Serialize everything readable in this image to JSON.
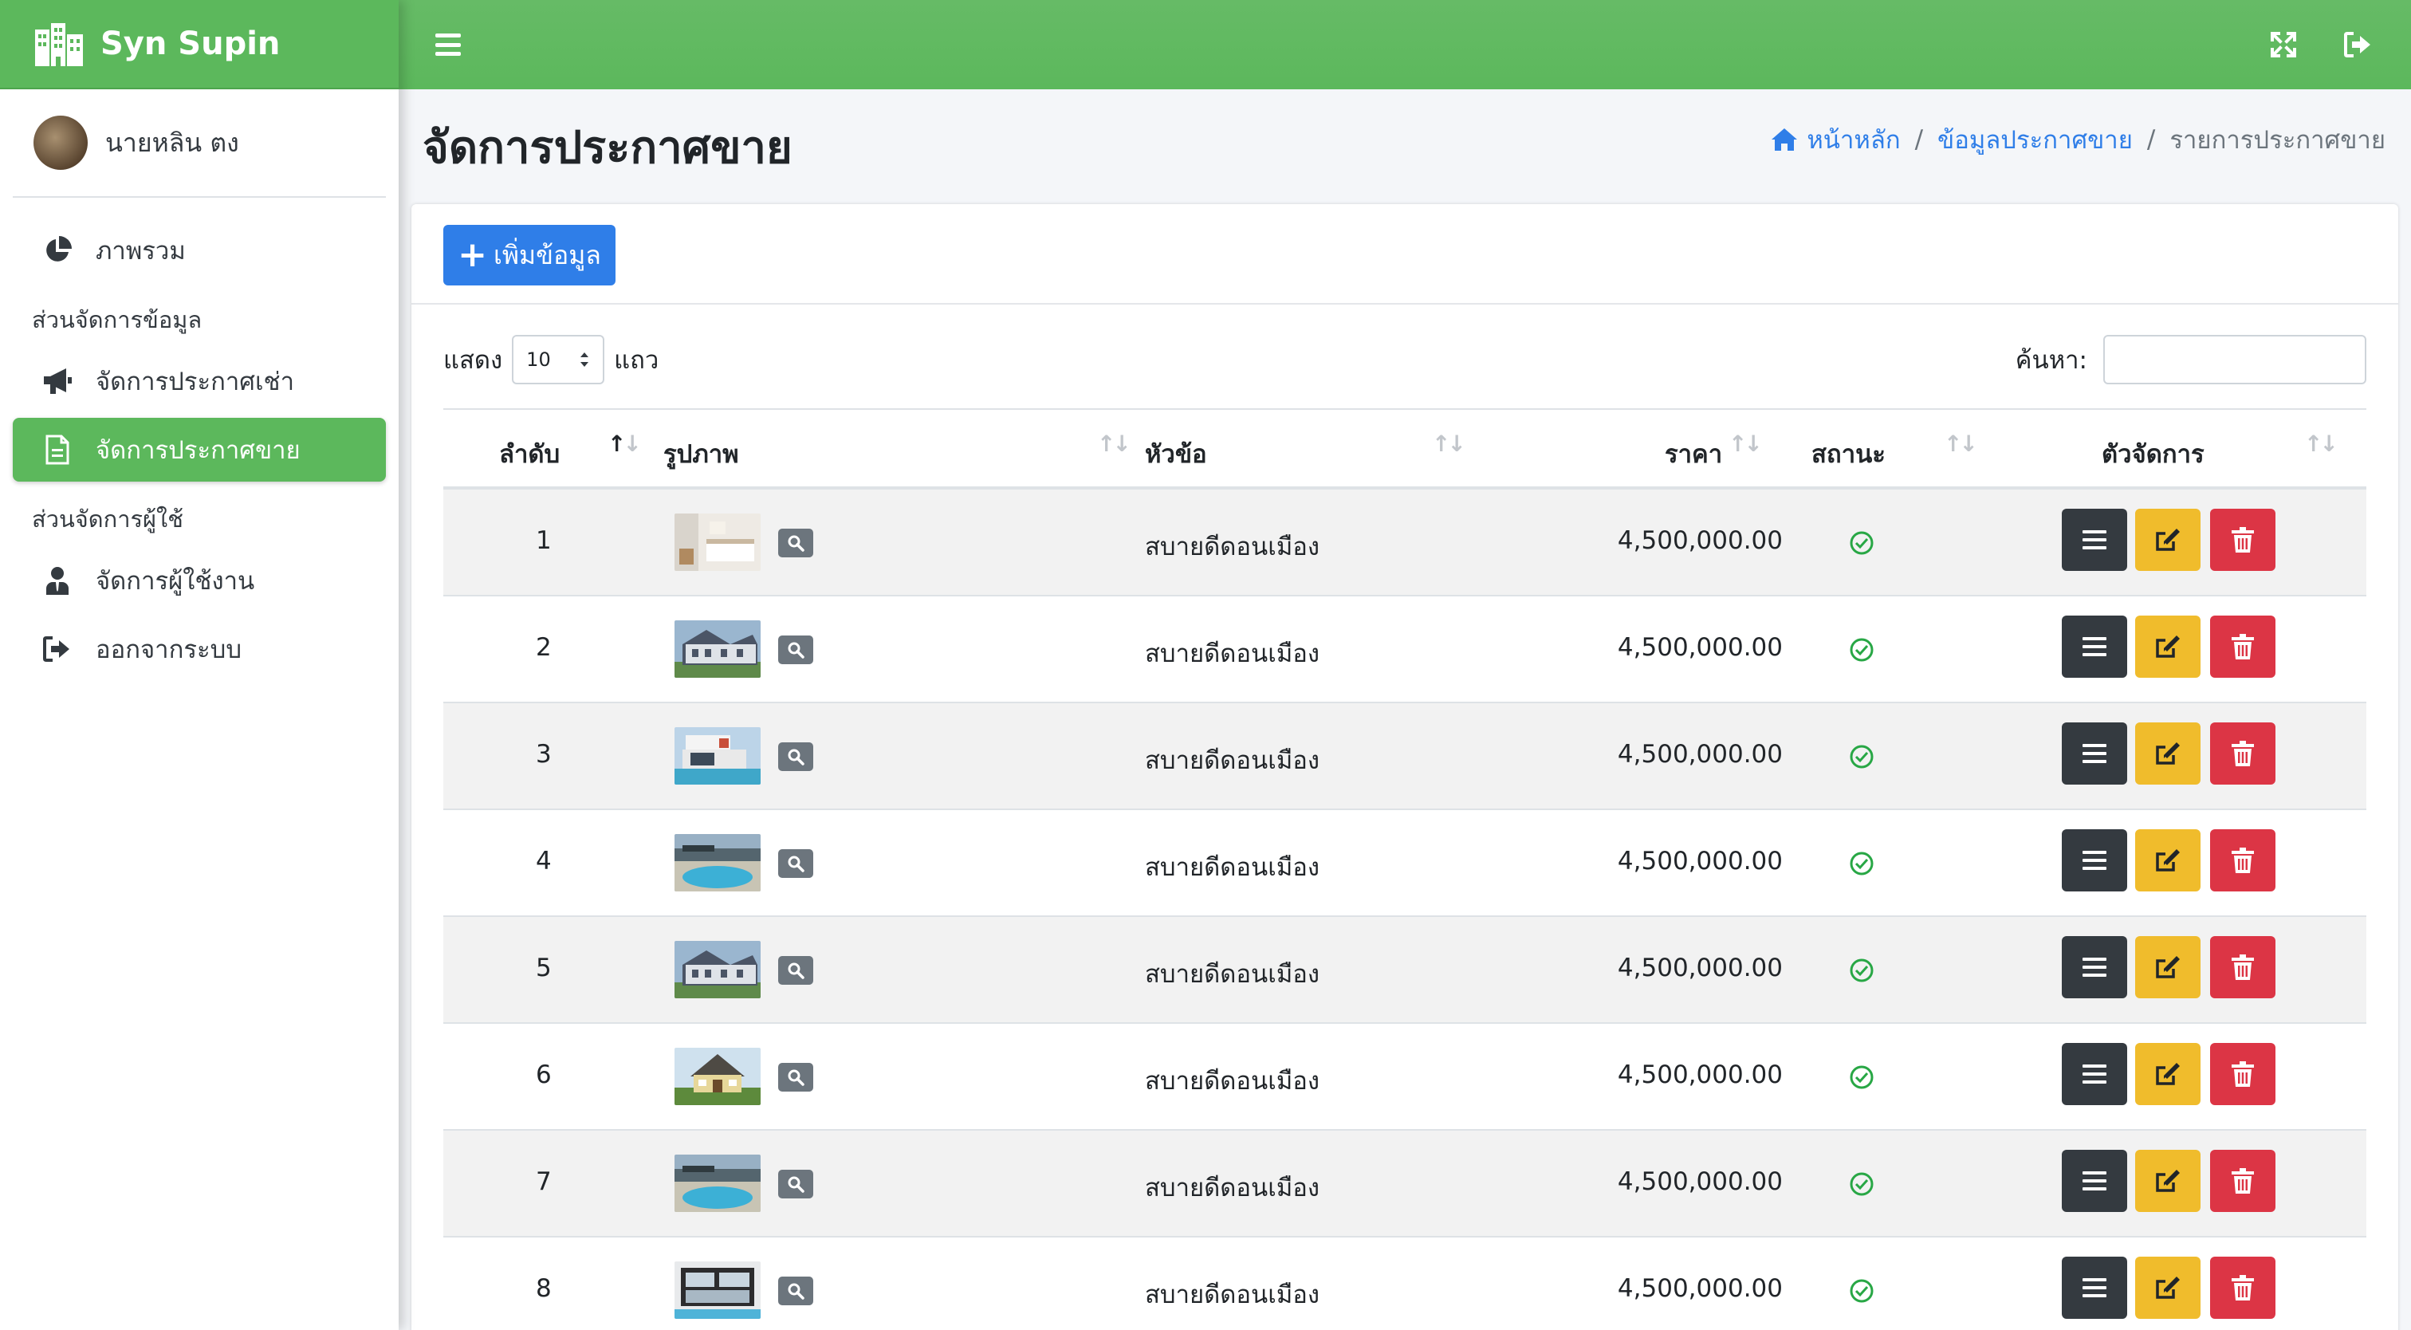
{
  "app": {
    "brand": "Syn Supin"
  },
  "user": {
    "name": "นายหลิน ตง"
  },
  "sidebar": {
    "overview": "ภาพรวม",
    "section_data": "ส่วนจัดการข้อมูล",
    "rent": "จัดการประกาศเช่า",
    "sale": "จัดการประกาศขาย",
    "section_users": "ส่วนจัดการผู้ใช้",
    "users": "จัดการผู้ใช้งาน",
    "logout": "ออกจากระบบ"
  },
  "page": {
    "title": "จัดการประกาศขาย"
  },
  "breadcrumb": {
    "home": "หน้าหลัก",
    "data": "ข้อมูลประกาศขาย",
    "current": "รายการประกาศขาย",
    "separator": "/"
  },
  "toolbar": {
    "add_label": "เพิ่มข้อมูล"
  },
  "table_controls": {
    "show_label": "แสดง",
    "page_size": "10",
    "rows_label": "แถว",
    "search_label": "ค้นหา:"
  },
  "table": {
    "columns": [
      "ลำดับ",
      "รูปภาพ",
      "หัวข้อ",
      "ราคา",
      "สถานะ",
      "ตัวจัดการ"
    ],
    "rows": [
      {
        "no": "1",
        "title": "สบายดีดอนเมือง",
        "price": "4,500,000.00",
        "thumb": "bedroom"
      },
      {
        "no": "2",
        "title": "สบายดีดอนเมือง",
        "price": "4,500,000.00",
        "thumb": "house-gray"
      },
      {
        "no": "3",
        "title": "สบายดีดอนเมือง",
        "price": "4,500,000.00",
        "thumb": "modern-pool"
      },
      {
        "no": "4",
        "title": "สบายดีดอนเมือง",
        "price": "4,500,000.00",
        "thumb": "pool"
      },
      {
        "no": "5",
        "title": "สบายดีดอนเมือง",
        "price": "4,500,000.00",
        "thumb": "house-gray"
      },
      {
        "no": "6",
        "title": "สบายดีดอนเมือง",
        "price": "4,500,000.00",
        "thumb": "house-yellow"
      },
      {
        "no": "7",
        "title": "สบายดีดอนเมือง",
        "price": "4,500,000.00",
        "thumb": "pool"
      },
      {
        "no": "8",
        "title": "สบายดีดอนเมือง",
        "price": "4,500,000.00",
        "thumb": "modern-dark"
      }
    ]
  },
  "colors": {
    "brand_green": "#5cb85c",
    "primary": "#2f7ee8",
    "warning": "#f0bc2c",
    "danger": "#dc3545",
    "dark": "#343a40",
    "success": "#28a745"
  },
  "icons": {
    "brand": "building-icon",
    "menu": "hamburger-icon",
    "fullscreen": "expand-icon",
    "signout": "sign-out-icon",
    "home": "home-icon"
  }
}
